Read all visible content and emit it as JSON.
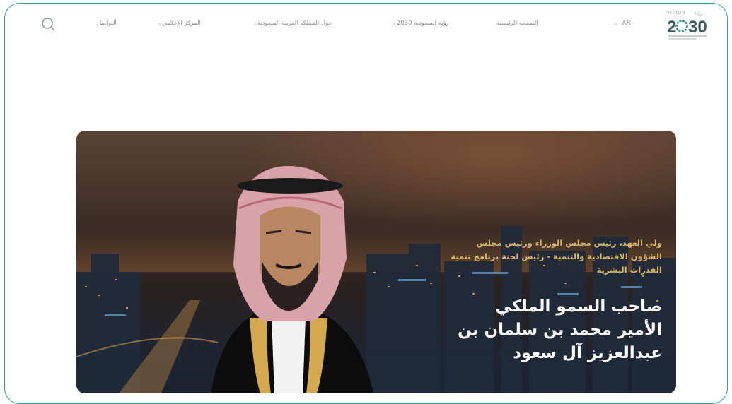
{
  "nav": {
    "language": "AR",
    "items": [
      {
        "label": "الصفحة الرئيسية",
        "dropdown": false
      },
      {
        "label": "رؤية السعودية 2030",
        "dropdown": true
      },
      {
        "label": "حول المملكة العربية السعودية",
        "dropdown": true
      },
      {
        "label": "المركز الإعلامي",
        "dropdown": true
      },
      {
        "label": "التواصل",
        "dropdown": false
      }
    ],
    "search_icon": "search-icon"
  },
  "logo": {
    "vision_text": "VISION",
    "arabic_text": "رؤية",
    "year": "2030"
  },
  "hero": {
    "subtitle": "ولي العهد، رئيس مجلس الوزراء ورئيس مجلس الشؤون الاقتصادية والتنمية - رئيس لجنة برنامج تنمية القدرات البشرية",
    "title": "صاحب السمو الملكي الأمير محمد بن سلمان بن عبدالعزيز آل سعود"
  },
  "colors": {
    "frame_border": "#2b9bb0",
    "gold_text": "#d9b86a",
    "logo_teal": "#2e8b8e"
  }
}
